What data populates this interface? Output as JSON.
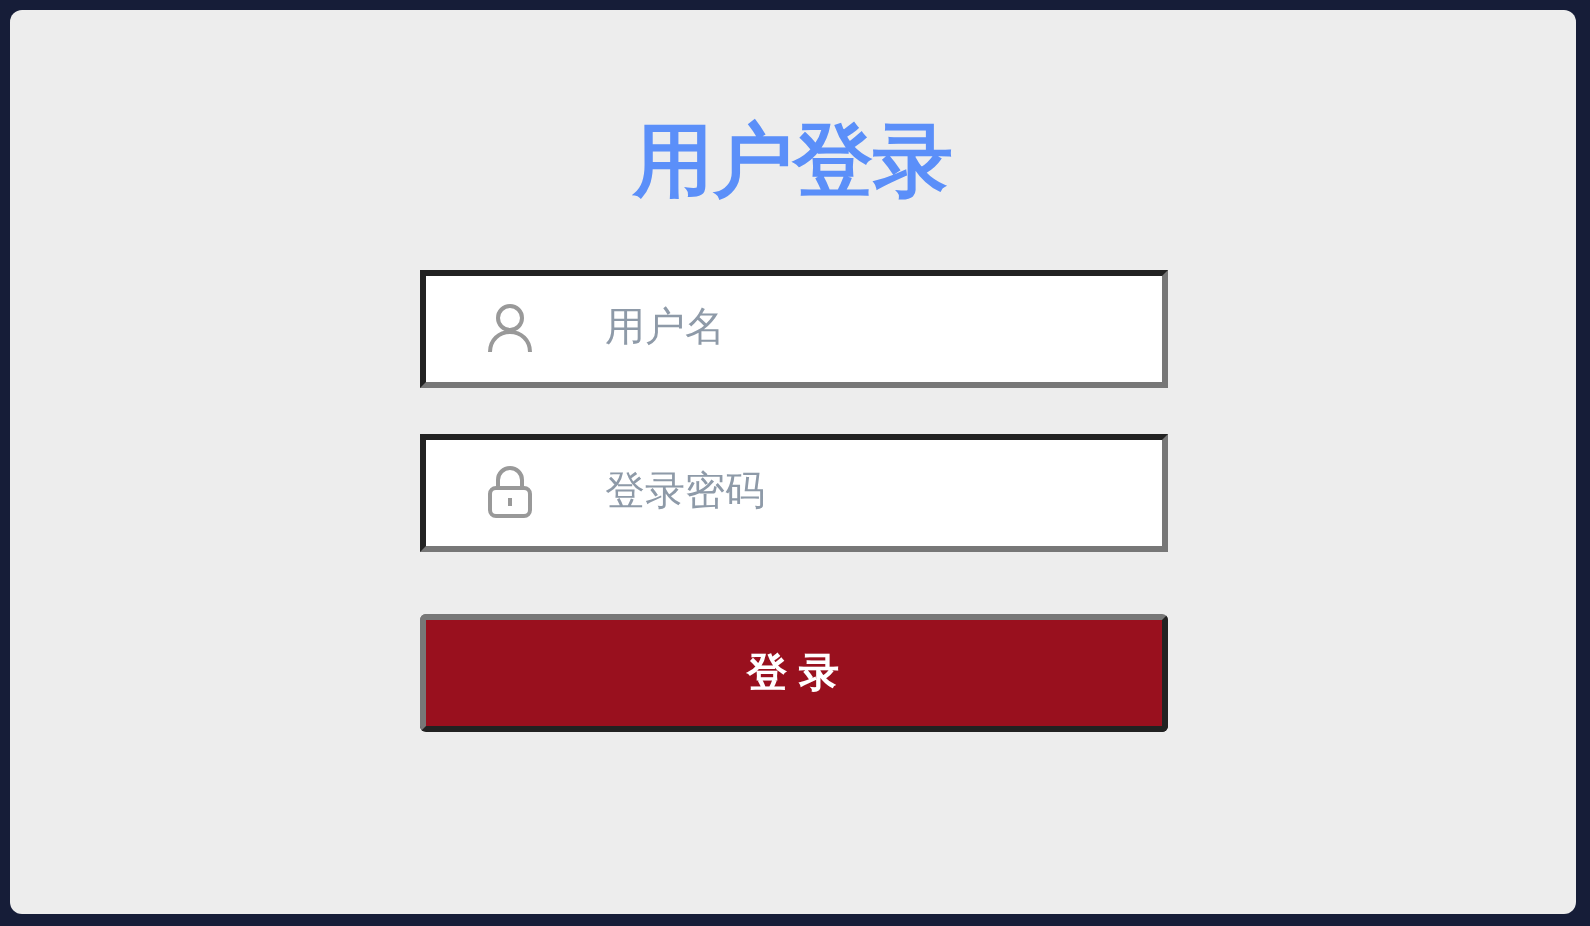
{
  "title": "用户登录",
  "fields": [
    {
      "kind": "user",
      "placeholder": "用户名"
    },
    {
      "kind": "password",
      "placeholder": "登录密码"
    }
  ],
  "button": "登 录"
}
